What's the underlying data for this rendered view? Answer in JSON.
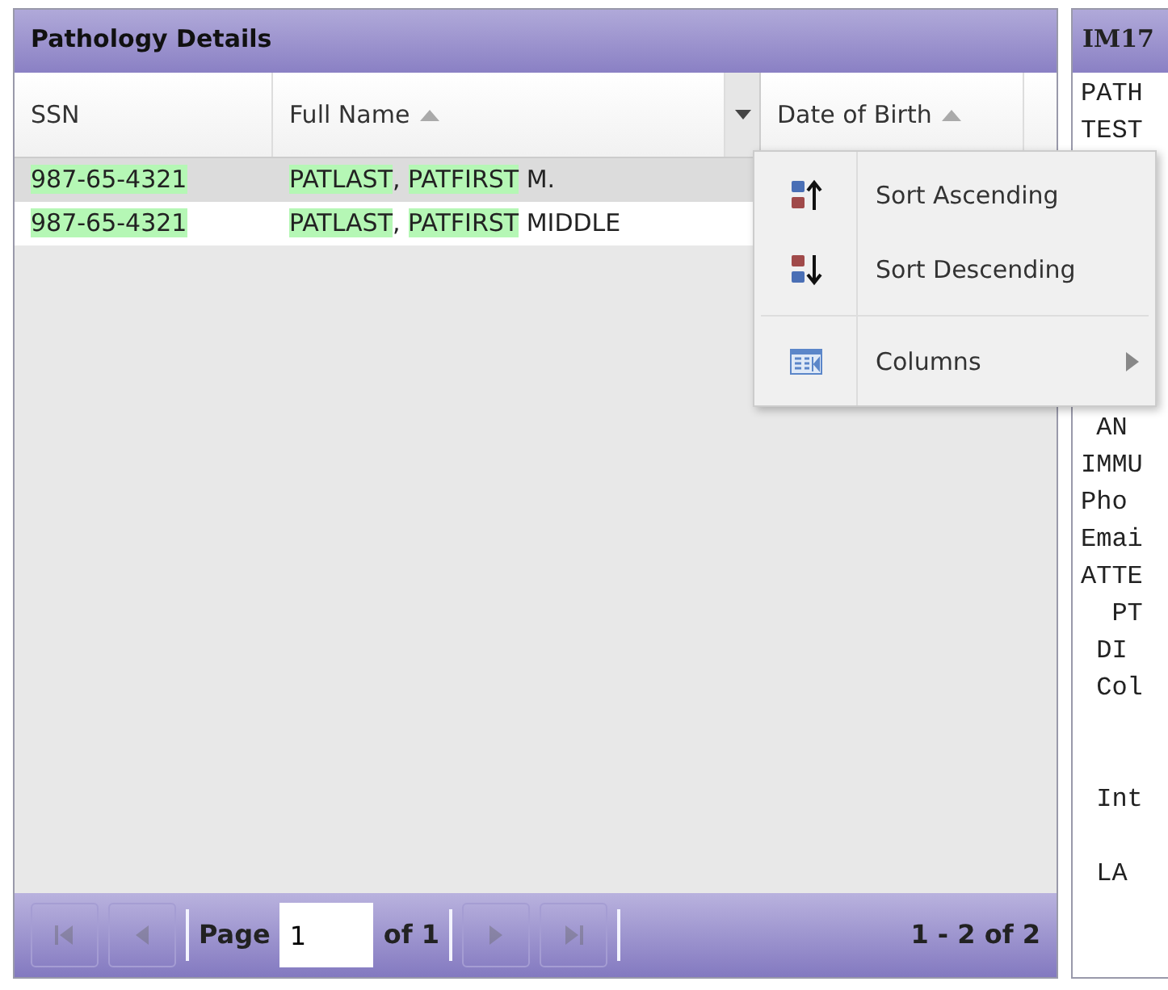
{
  "left_panel": {
    "title": "Pathology Details",
    "columns": [
      {
        "label": "SSN",
        "sorted": false,
        "menu_trigger": false
      },
      {
        "label": "Full Name",
        "sorted": true,
        "menu_trigger": true
      },
      {
        "label": "Date of Birth",
        "sorted": true,
        "menu_trigger": false
      }
    ],
    "rows": [
      {
        "selected": true,
        "cells": [
          [
            {
              "text": "987-65-4321",
              "highlighted": true
            }
          ],
          [
            {
              "text": "PATLAST",
              "highlighted": true
            },
            {
              "text": ", ",
              "highlighted": false
            },
            {
              "text": "PATFIRST",
              "highlighted": true
            },
            {
              "text": " M.",
              "highlighted": false
            }
          ]
        ]
      },
      {
        "selected": false,
        "cells": [
          [
            {
              "text": "987-65-4321",
              "highlighted": true
            }
          ],
          [
            {
              "text": "PATLAST",
              "highlighted": true
            },
            {
              "text": ", ",
              "highlighted": false
            },
            {
              "text": "PATFIRST",
              "highlighted": true
            },
            {
              "text": " MIDDLE",
              "highlighted": false
            }
          ]
        ]
      }
    ],
    "pager": {
      "first_disabled": true,
      "prev_disabled": true,
      "page_label": "Page",
      "page": "1",
      "of": "of 1",
      "next_disabled": true,
      "last_disabled": true,
      "summary": "1 - 2 of 2"
    }
  },
  "right_panel": {
    "title": "IM17",
    "lines": [
      {
        "kind": "text",
        "text": "PATH"
      },
      {
        "kind": "text",
        "text": "TEST"
      },
      {
        "kind": "blank"
      },
      {
        "kind": "blank"
      },
      {
        "kind": "blank"
      },
      {
        "kind": "blank"
      },
      {
        "kind": "blank"
      },
      {
        "kind": "blank"
      },
      {
        "kind": "blank"
      },
      {
        "kind": "text",
        "text": " AN"
      },
      {
        "kind": "text",
        "text": "IMMU"
      },
      {
        "kind": "text",
        "text": "Pho"
      },
      {
        "kind": "text",
        "text": "Emai"
      },
      {
        "kind": "text",
        "text": "ATTE"
      },
      {
        "kind": "text",
        "text": "  PT"
      },
      {
        "kind": "text",
        "text": " DI"
      },
      {
        "kind": "text",
        "text": " Col"
      },
      {
        "kind": "blank"
      },
      {
        "kind": "blank"
      },
      {
        "kind": "text",
        "text": " Int"
      },
      {
        "kind": "blank"
      },
      {
        "kind": "text",
        "text": " LA"
      }
    ]
  },
  "column_menu": {
    "items": [
      {
        "kind": "sort-asc",
        "label": "Sort Ascending"
      },
      {
        "kind": "sort-desc",
        "label": "Sort Descending"
      },
      {
        "kind": "separator"
      },
      {
        "kind": "columns",
        "label": "Columns",
        "submenu": true
      }
    ]
  }
}
